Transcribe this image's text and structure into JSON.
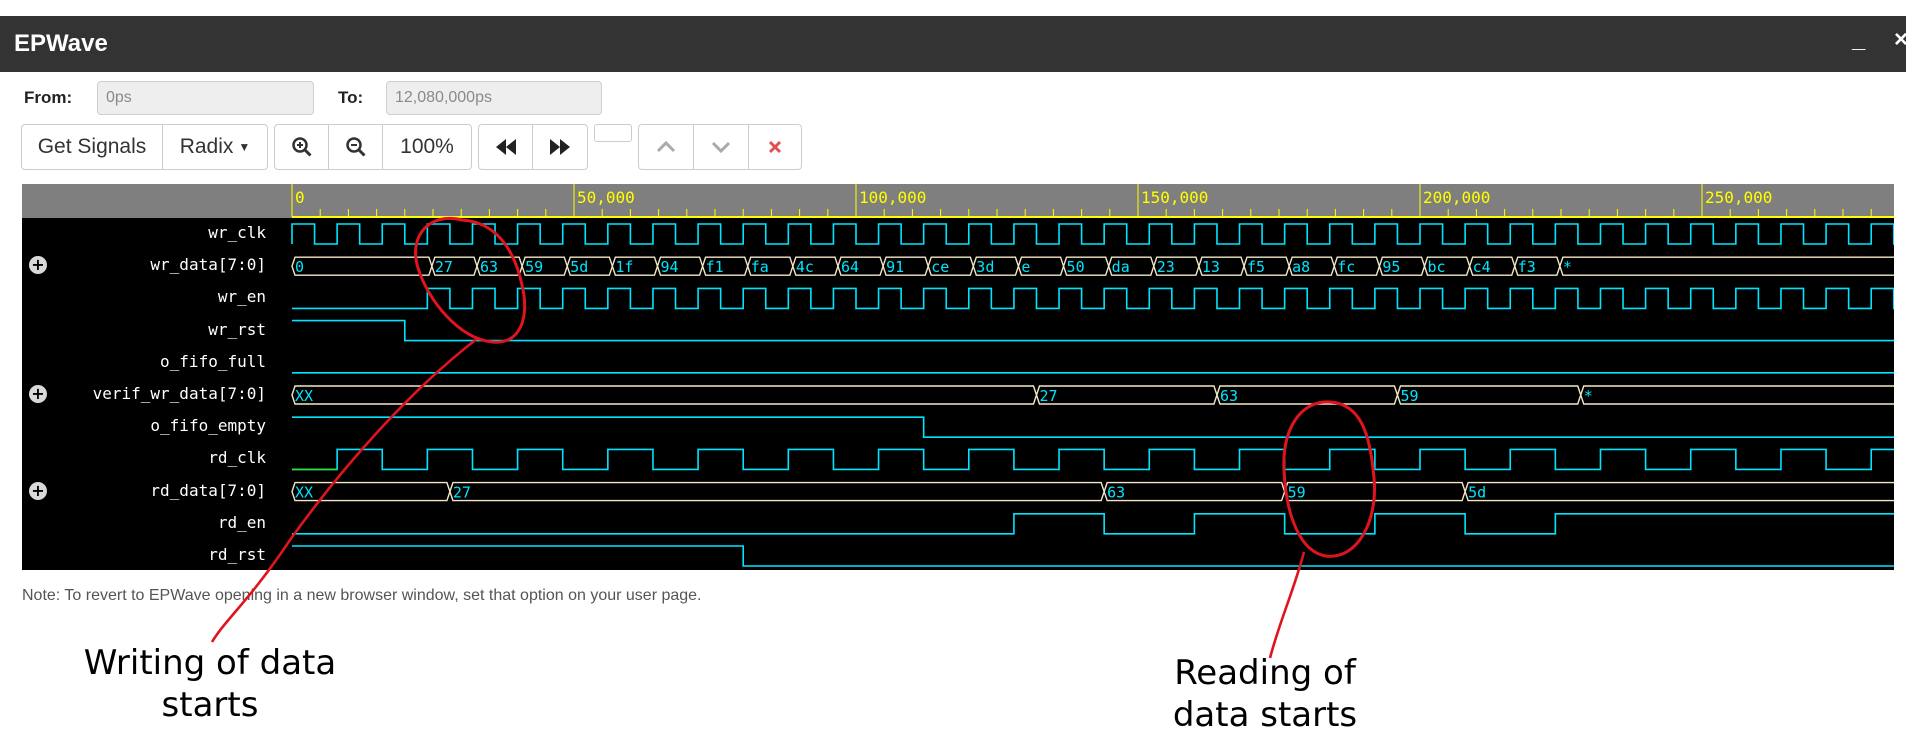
{
  "window": {
    "title": "EPWave",
    "minimize_label": "_",
    "close_label": "×"
  },
  "range": {
    "from_label": "From:",
    "from_value": "0ps",
    "to_label": "To:",
    "to_value": "12,080,000ps"
  },
  "toolbar": {
    "get_signals": "Get Signals",
    "radix": "Radix",
    "zoom_level": "100%"
  },
  "ruler": {
    "ticks": [
      "0",
      "50,000",
      "100,000",
      "150,000",
      "200,000",
      "250,000"
    ]
  },
  "signals": [
    {
      "name": "wr_clk",
      "expandable": false
    },
    {
      "name": "wr_data[7:0]",
      "expandable": true,
      "values": [
        "0",
        "27",
        "63",
        "59",
        "5d",
        "1f",
        "94",
        "f1",
        "fa",
        "4c",
        "64",
        "91",
        "ce",
        "3d",
        "e",
        "50",
        "da",
        "23",
        "13",
        "f5",
        "a8",
        "fc",
        "95",
        "bc",
        "c4",
        "f3",
        "*"
      ]
    },
    {
      "name": "wr_en",
      "expandable": false
    },
    {
      "name": "wr_rst",
      "expandable": false
    },
    {
      "name": "o_fifo_full",
      "expandable": false
    },
    {
      "name": "verif_wr_data[7:0]",
      "expandable": true,
      "values": [
        "XX",
        "27",
        "63",
        "59",
        "*"
      ]
    },
    {
      "name": "o_fifo_empty",
      "expandable": false
    },
    {
      "name": "rd_clk",
      "expandable": false
    },
    {
      "name": "rd_data[7:0]",
      "expandable": true,
      "values": [
        "XX",
        "27",
        "63",
        "59",
        "5d"
      ]
    },
    {
      "name": "rd_en",
      "expandable": false
    },
    {
      "name": "rd_rst",
      "expandable": false
    }
  ],
  "note": "Note: To revert to EPWave opening in a new browser window, set that option on your user page.",
  "annotations": {
    "write_start": {
      "line1": "Writing of data",
      "line2": "starts"
    },
    "read_start": {
      "line1": "Reading of",
      "line2": "data starts"
    }
  },
  "colors": {
    "wave_cyan": "#00e5ff",
    "wave_green": "#33dd33",
    "bus_cream": "#f2e8c8",
    "ruler_yellow": "#ffff00",
    "annotation_red": "#e0141e"
  }
}
